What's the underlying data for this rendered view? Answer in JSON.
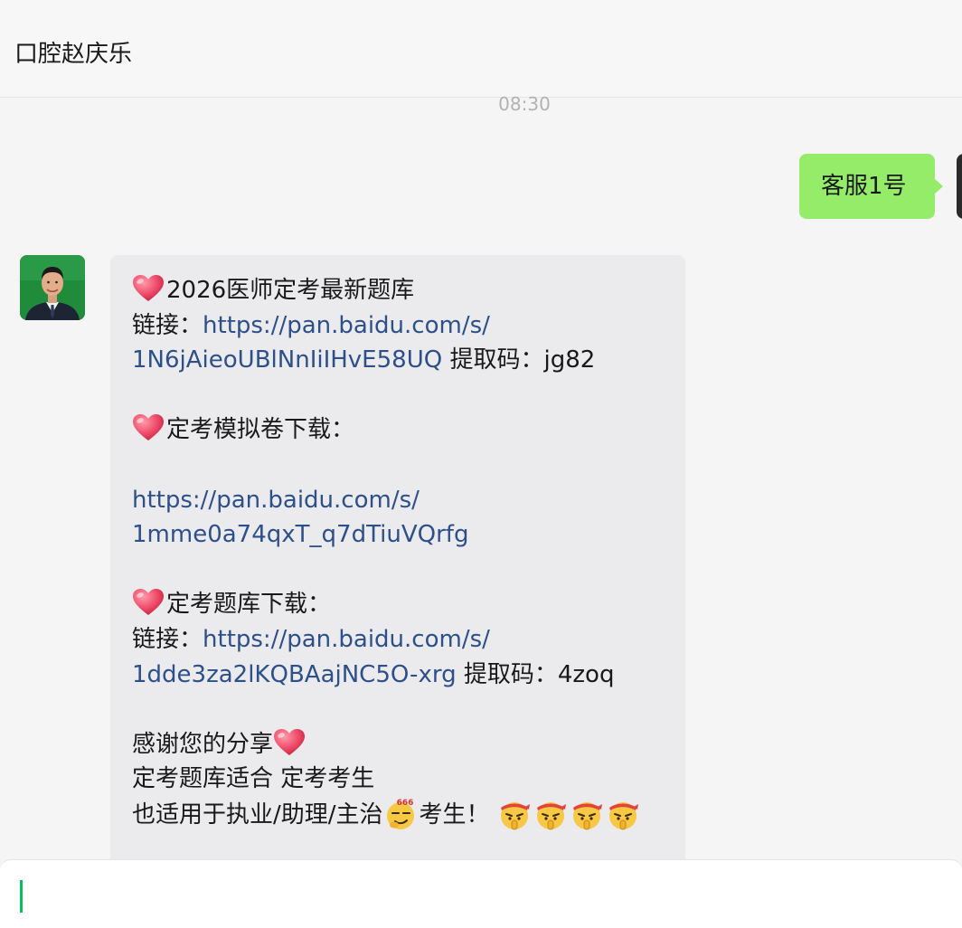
{
  "header": {
    "title": "口腔赵庆乐"
  },
  "chat": {
    "timestamp": "08:30",
    "sent_message": "客服1号",
    "received": {
      "lines": [
        {
          "type": "text",
          "parts": [
            {
              "kind": "heart"
            },
            {
              "kind": "text",
              "value": "2026医师定考最新题库"
            }
          ]
        },
        {
          "type": "text",
          "parts": [
            {
              "kind": "text",
              "value": "链接："
            },
            {
              "kind": "link",
              "value": "https://pan.baidu.com/s/"
            }
          ]
        },
        {
          "type": "text",
          "parts": [
            {
              "kind": "link",
              "value": "1N6jAieoUBlNnIiIHvE58UQ"
            },
            {
              "kind": "text",
              "value": " 提取码：jg82"
            }
          ]
        },
        {
          "type": "blank"
        },
        {
          "type": "text",
          "parts": [
            {
              "kind": "heart"
            },
            {
              "kind": "text",
              "value": "定考模拟卷下载："
            }
          ]
        },
        {
          "type": "blank"
        },
        {
          "type": "text",
          "parts": [
            {
              "kind": "link",
              "value": "https://pan.baidu.com/s/"
            }
          ]
        },
        {
          "type": "text",
          "parts": [
            {
              "kind": "link",
              "value": "1mme0a74qxT_q7dTiuVQrfg"
            }
          ]
        },
        {
          "type": "blank"
        },
        {
          "type": "text",
          "parts": [
            {
              "kind": "heart"
            },
            {
              "kind": "text",
              "value": "定考题库下载："
            }
          ]
        },
        {
          "type": "text",
          "parts": [
            {
              "kind": "text",
              "value": "链接："
            },
            {
              "kind": "link",
              "value": "https://pan.baidu.com/s/"
            }
          ]
        },
        {
          "type": "text",
          "parts": [
            {
              "kind": "link",
              "value": "1dde3za2lKQBAajNC5O-xrg"
            },
            {
              "kind": "text",
              "value": " 提取码：4zoq"
            }
          ]
        },
        {
          "type": "blank"
        },
        {
          "type": "text",
          "parts": [
            {
              "kind": "text",
              "value": "感谢您的分享"
            },
            {
              "kind": "heart"
            }
          ]
        },
        {
          "type": "text",
          "parts": [
            {
              "kind": "text",
              "value": "定考题库适合 定考考生"
            }
          ]
        },
        {
          "type": "text",
          "parts": [
            {
              "kind": "text",
              "value": "也适用于执业/助理/主治"
            },
            {
              "kind": "emoji666"
            },
            {
              "kind": "text",
              "value": "考生！ "
            },
            {
              "kind": "emojiHush"
            },
            {
              "kind": "emojiHush"
            },
            {
              "kind": "emojiHush"
            },
            {
              "kind": "emojiHush"
            }
          ]
        }
      ]
    },
    "emoji_666_label": "666"
  },
  "colors": {
    "sent_bubble": "#95ec69",
    "received_bubble": "#ebebee",
    "link": "#2d4f8a",
    "heart": "#f0506e",
    "caret": "#07c160"
  },
  "icons": {
    "heart": "red-heart-icon",
    "emoji666": "smirk-666-emoji",
    "emojiHush": "shushing-headband-emoji"
  }
}
